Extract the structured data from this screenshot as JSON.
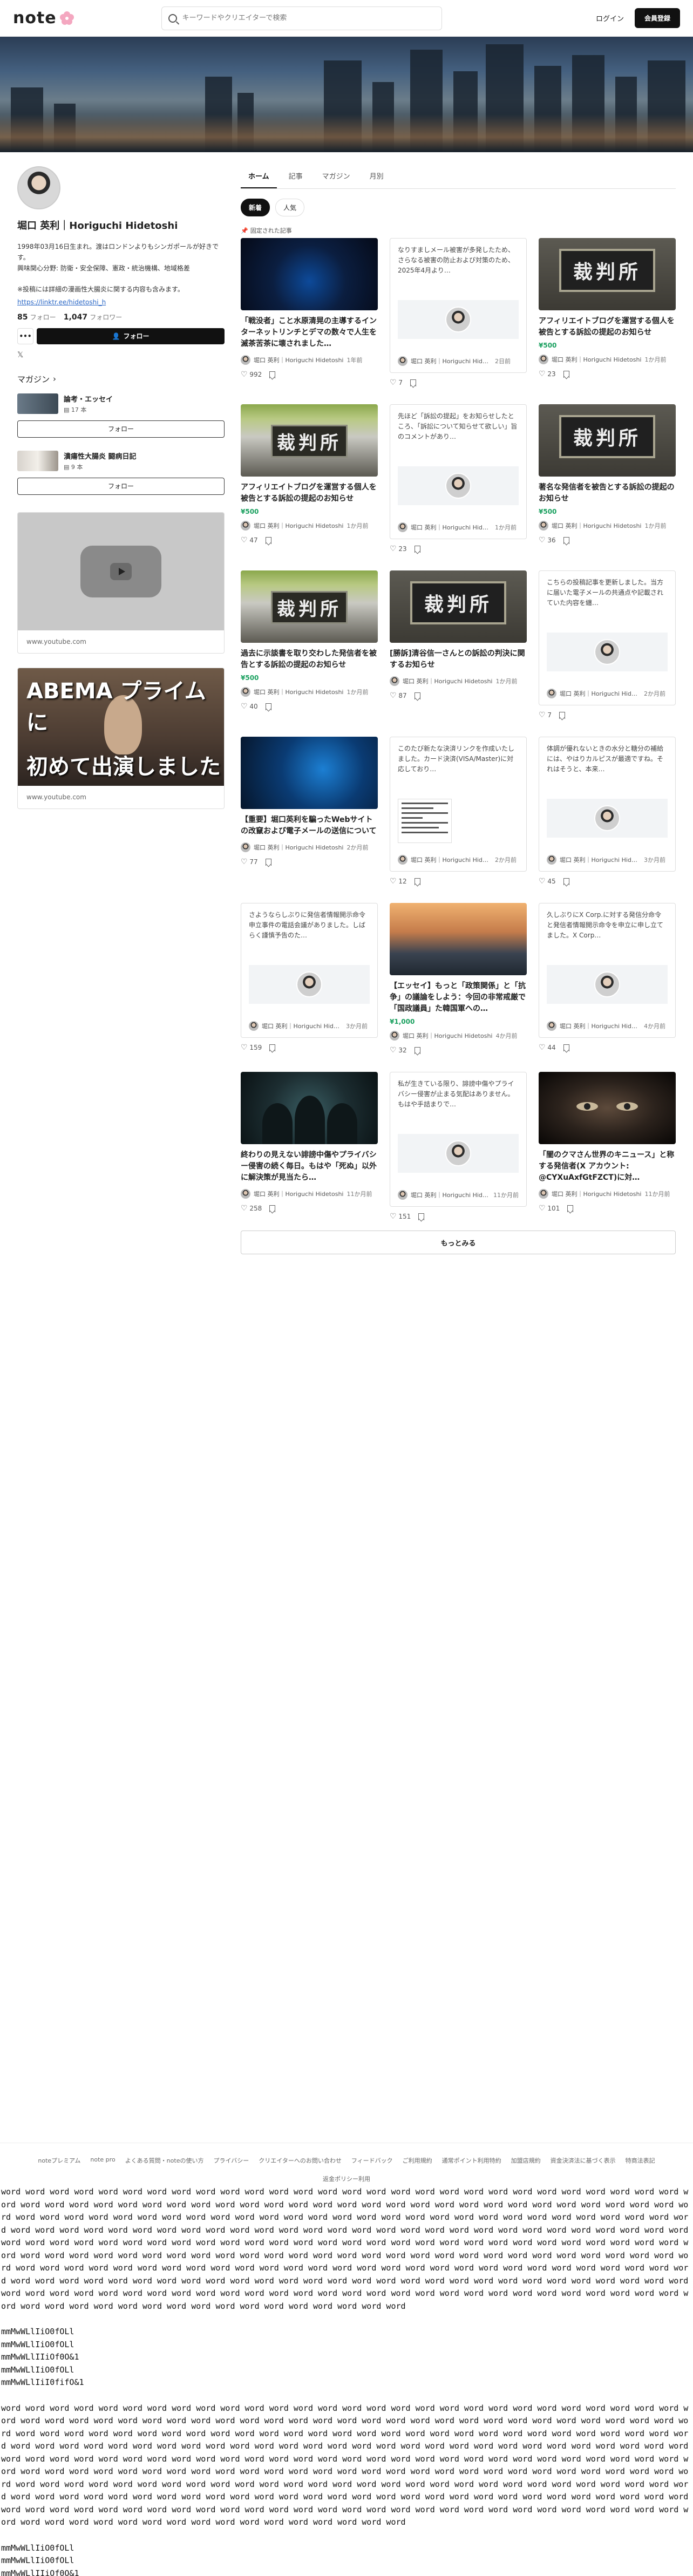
{
  "header": {
    "logo": "note",
    "search_placeholder": "キーワードやクリエイターで検索",
    "login": "ログイン",
    "signup": "会員登録"
  },
  "profile": {
    "name": "堀口 英利｜Horiguchi Hidetoshi",
    "bio": "1998年03月16日生まれ。渡はロンドンよりもシンガポールが好きです。\n興味関心分野: 防衛・安全保障、憲政・統治機構、地域格差\n\n※投稿には詳細の漫画性大腸炎に関する内容も含みます。",
    "link": "https://linktr.ee/hidetoshi_h",
    "followers_count": "85",
    "followers_label": "フォロー",
    "following_count": "1,047",
    "following_label": "フォロワー",
    "more": "•••",
    "follow_button": "フォロー",
    "x_icon": "𝕏"
  },
  "magazines": {
    "heading": "マガジン",
    "items": [
      {
        "title": "論考・エッセイ",
        "count": "17 本",
        "follow": "フォロー"
      },
      {
        "title": "潰瘍性大腸炎 闘病日記",
        "count": "9 本",
        "follow": "フォロー"
      }
    ]
  },
  "embeds": [
    {
      "caption": "www.youtube.com"
    },
    {
      "caption": "www.youtube.com",
      "line1": "ABEMA プライムに",
      "line2": "初めて出演しました"
    }
  ],
  "tabs": [
    "ホーム",
    "記事",
    "マガジン",
    "月別"
  ],
  "subtabs": [
    "新着",
    "人気"
  ],
  "pinned_label": "固定された記事",
  "author": "堀口 英利｜Horiguchi Hidetoshi",
  "articles": [
    {
      "type": "image",
      "art": "hacker",
      "title": "「戦没者」こと水原清晃の主導するインターネットリンチとデマの数々で人生を滅茶苦茶に壊されました…",
      "price": "",
      "author": "堀口 英利｜Horiguchi Hidetoshi",
      "time": "1年前",
      "likes": "992"
    },
    {
      "type": "text",
      "excerpt": "なりすましメール被害が多発したため、さらなる被害の防止および対策のため、2025年4月より…",
      "author": "堀口 英利｜Horiguchi Hidetoshi",
      "time": "2日前",
      "likes": "7"
    },
    {
      "type": "image",
      "art": "court2",
      "title": "アフィリエイトブログを運営する個人を被告とする訴訟の提起のお知らせ",
      "price": "¥500",
      "author": "堀口 英利｜Horiguchi Hidetoshi",
      "time": "1か月前",
      "likes": "23"
    },
    {
      "type": "image",
      "art": "court",
      "title": "アフィリエイトブログを運営する個人を被告とする訴訟の提起のお知らせ",
      "price": "¥500",
      "author": "堀口 英利｜Horiguchi Hidetoshi",
      "time": "1か月前",
      "likes": "47"
    },
    {
      "type": "text",
      "excerpt": "先ほど「訴訟の提起」をお知らせしたところ、「訴訟について知らせて欲しい」旨のコメントがあり…",
      "author": "堀口 英利｜Horiguchi Hidetoshi",
      "time": "1か月前",
      "likes": "23"
    },
    {
      "type": "image",
      "art": "court2",
      "title": "著名な発信者を被告とする訴訟の提起のお知らせ",
      "price": "¥500",
      "author": "堀口 英利｜Horiguchi Hidetoshi",
      "time": "1か月前",
      "likes": "36"
    },
    {
      "type": "image",
      "art": "court",
      "title": "過去に示談書を取り交わした発信者を被告とする訴訟の提起のお知らせ",
      "price": "¥500",
      "author": "堀口 英利｜Horiguchi Hidetoshi",
      "time": "1か月前",
      "likes": "40"
    },
    {
      "type": "image",
      "art": "court2",
      "title": "[勝訴]清谷信一さんとの訴訟の判決に関するお知らせ",
      "price": "",
      "author": "堀口 英利｜Horiguchi Hidetoshi",
      "time": "1か月前",
      "likes": "87"
    },
    {
      "type": "text",
      "excerpt": "こちらの投稿記事を更新しました。当方に届いた電子メールの共通点や記載されていた内容を纏…",
      "author": "堀口 英利｜Horiguchi Hidetoshi",
      "time": "2か月前",
      "likes": "7"
    },
    {
      "type": "image",
      "art": "laptop",
      "title": "【重要】堀口英利を騙ったWebサイトの改竄および電子メールの送信について",
      "price": "",
      "author": "堀口 英利｜Horiguchi Hidetoshi",
      "time": "2か月前",
      "likes": "77"
    },
    {
      "type": "doc",
      "excerpt": "このたび新たな決済リンクを作成いたしました。カード決済(VISA/Master)に対応しており…",
      "author": "堀口 英利｜Horiguchi Hidetoshi",
      "time": "2か月前",
      "likes": "12"
    },
    {
      "type": "text",
      "excerpt": "体調が優れないときの水分と糖分の補給には、やはりカルピスが最適ですね。それはそうと、本来…",
      "author": "堀口 英利｜Horiguchi Hidetoshi",
      "time": "3か月前",
      "likes": "45"
    },
    {
      "type": "text",
      "excerpt": "さようならしぶりに発信者情報開示命令申立事件の電話会議がありました。しばらく謹慎予告のた…",
      "author": "堀口 英利｜Horiguchi Hidetoshi",
      "time": "3か月前",
      "likes": "159"
    },
    {
      "type": "image",
      "art": "city",
      "title": "【エッセイ】もっと「政策関係」と「抗争」の議論をしよう：今回の非常戒厳で「国政議員」た韓国軍への…",
      "price": "¥1,000",
      "author": "堀口 英利｜Horiguchi Hidetoshi",
      "time": "4か月前",
      "likes": "32"
    },
    {
      "type": "text",
      "excerpt": "久しぶりにX Corp.に対する発信分命令と発信者情報開示命令を申立に申し立てました。X Corp…",
      "author": "堀口 英利｜Horiguchi Hidetoshi",
      "time": "4か月前",
      "likes": "44"
    },
    {
      "type": "image",
      "art": "hood",
      "title": "終わりの見えない誹謗中傷やプライバシー侵害の続く毎日。もはや「死ぬ」以外に解決策が見当たら…",
      "price": "",
      "author": "堀口 英利｜Horiguchi Hidetoshi",
      "time": "11か月前",
      "likes": "258"
    },
    {
      "type": "text",
      "excerpt": "私が生きている限り、誹謗中傷やプライバシー侵害が止まる気配はありません。もはや手詰まりで…",
      "author": "堀口 英利｜Horiguchi Hidetoshi",
      "time": "11か月前",
      "likes": "151"
    },
    {
      "type": "image",
      "art": "eyes",
      "title": "「闇のクマさん世界のキニュース」と称する発信者(X アカウント: @CYXuAxfGtFZCT)に対…",
      "price": "",
      "author": "堀口 英利｜Horiguchi Hidetoshi",
      "time": "11か月前",
      "likes": "101"
    }
  ],
  "more_button": "もっとみる",
  "footer": {
    "links": [
      "noteプレミアム",
      "note pro",
      "よくある質問・noteの使い方",
      "プライバシー",
      "クリエイターへのお問い合わせ",
      "フィードバック",
      "ご利用規約",
      "通常ポイント利用特約",
      "加盟店規約",
      "資金決済法に基づく表示",
      "特商法表記"
    ],
    "bottom": "返金ポリシー利用"
  },
  "filler": {
    "word_line": "word word word word word word word word word word word word word word word word word word word word word word word word word word word word word word word word word word word word word word word word word word word word word word word word word word word word word word word word word word word word word word word word word word word word word word word word word word word word word word word word word word word word word word word word word word word word word word word word word word word word word word word word word word word word word word word word word word word word word word word word word word word word word word word word word word word word word word word word word word word word word word word word word word word word word word word word word word word word word word word word word word word word word word word word word word word word word word word word word word word word word word word word word word word word word word word word word word word word word word word word word word word word word word word word word word word word word word word word word word word word word word word word word word word word word word word word word word word word word word word word word word word word word word word word word word word word word word word word word word word word word word word word word word word word word word word",
    "mono_lines": [
      "mmMwWLlIiO0fOLl",
      "mmMwWLlIiO0fOLl",
      "mmMwWLlIIiOf0O&1",
      "mmMwWLlIiO0fOLl",
      "mmMwWLlIiI0fifO&1"
    ],
    "mono_lines2": [
      "mmMwWLlIiO0fOLl",
      "mmMwWLlIiO0fOLl",
      "mmMwWLlIIiOf0O&1",
      "mmMwWLlIiO0fOLl",
      "mmMwWLlIiI0fifO&1"
    ],
    "mono_lines3": [
      "mmMwWLlIiO0fOLl"
    ]
  }
}
